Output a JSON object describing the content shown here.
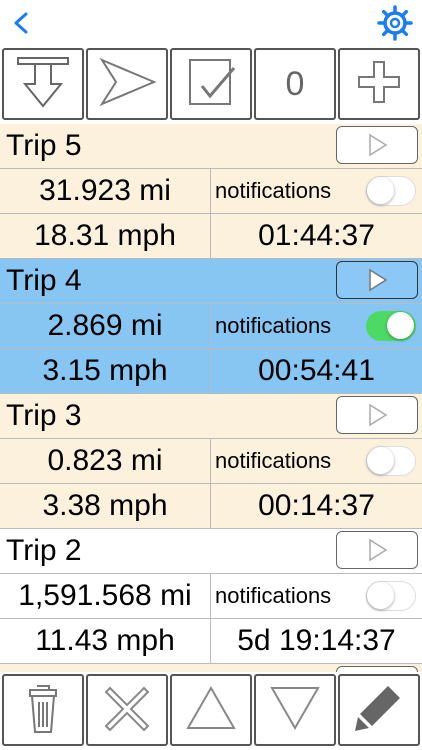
{
  "colors": {
    "accent": "#1a7cf2",
    "row_beige": "#fcf1dc",
    "row_selected": "#87c5f3",
    "toggle_on": "#4cd964",
    "border": "#555555"
  },
  "navbar": {
    "back_icon": "chevron-left-icon",
    "settings_icon": "gear-icon"
  },
  "toolbar": {
    "buttons": [
      {
        "icon": "import-arrow-down-icon"
      },
      {
        "icon": "send-paper-plane-icon"
      },
      {
        "icon": "checkbox-icon"
      },
      {
        "icon": "counter",
        "label": "0"
      },
      {
        "icon": "plus-icon"
      }
    ]
  },
  "trips": [
    {
      "name": "Trip 5",
      "distance": "31.923 mi",
      "speed": "18.31 mph",
      "duration": "01:44:37",
      "notifications_label": "notifications",
      "notifications_on": false,
      "selected": false
    },
    {
      "name": "Trip 4",
      "distance": "2.869 mi",
      "speed": "3.15 mph",
      "duration": "00:54:41",
      "notifications_label": "notifications",
      "notifications_on": true,
      "selected": true
    },
    {
      "name": "Trip 3",
      "distance": "0.823 mi",
      "speed": "3.38 mph",
      "duration": "00:14:37",
      "notifications_label": "notifications",
      "notifications_on": false,
      "selected": false
    },
    {
      "name": "Trip 2",
      "distance": "1,591.568 mi",
      "speed": "11.43 mph",
      "duration": "5d 19:14:37",
      "notifications_label": "notifications",
      "notifications_on": false,
      "selected": false
    }
  ],
  "bottom_toolbar": {
    "buttons": [
      {
        "icon": "trash-icon"
      },
      {
        "icon": "close-x-icon"
      },
      {
        "icon": "move-up-triangle-icon"
      },
      {
        "icon": "move-down-triangle-icon"
      },
      {
        "icon": "pencil-edit-icon"
      }
    ]
  }
}
